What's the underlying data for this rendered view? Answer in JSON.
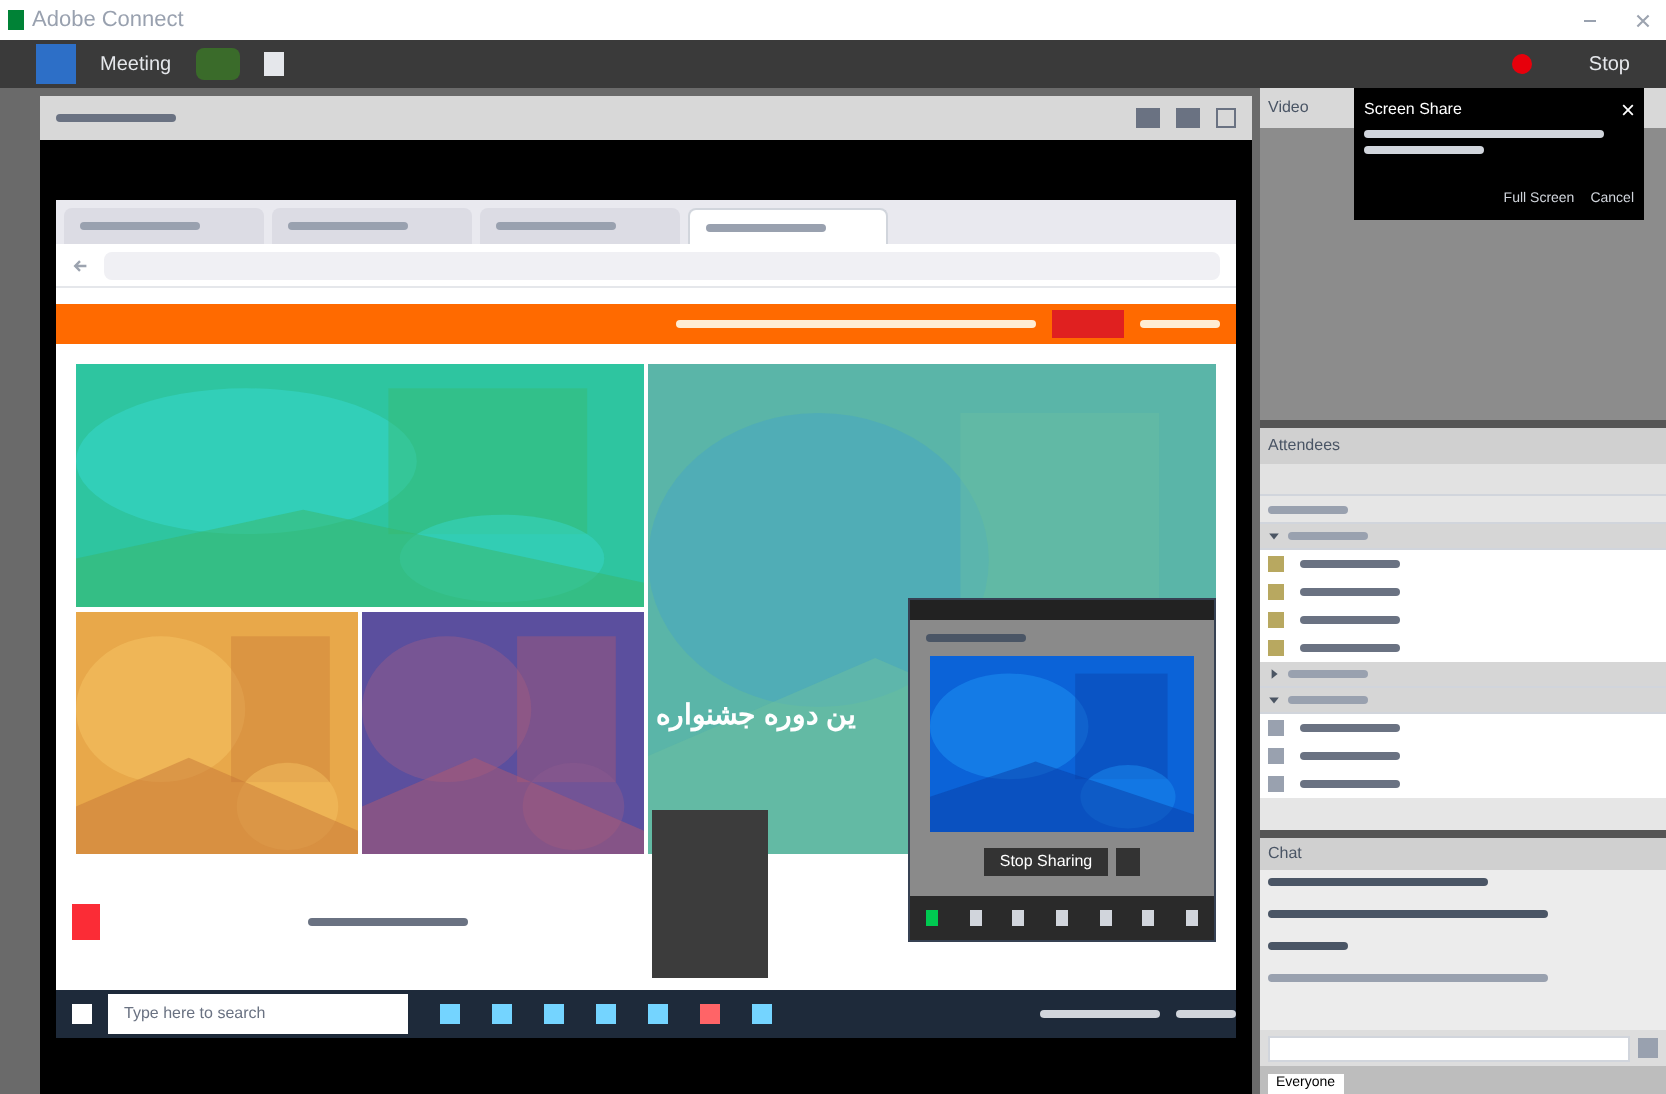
{
  "window": {
    "title": "Adobe Connect"
  },
  "menu_bar": {
    "items": [
      {
        "label": "Meeting"
      }
    ],
    "stop_label": "Stop"
  },
  "browser": {
    "tabs": [
      {
        "selected": false
      },
      {
        "selected": false
      },
      {
        "selected": false
      },
      {
        "selected": true
      }
    ]
  },
  "hero": {
    "heading": "ین دوره جشنواره"
  },
  "taskbar": {
    "search_placeholder": "Type here to search"
  },
  "mini_window": {
    "button": "Stop Sharing"
  },
  "notification": {
    "title": "Screen Share",
    "actions": [
      "Full Screen",
      "Cancel"
    ]
  },
  "video_pod": {
    "title": "Video"
  },
  "attendees": {
    "title": "Attendees",
    "groups": [
      {
        "expanded": true,
        "rows": [
          {
            "kind": "host"
          },
          {
            "kind": "host"
          },
          {
            "kind": "host"
          },
          {
            "kind": "host"
          }
        ]
      },
      {
        "expanded": false
      },
      {
        "expanded": true,
        "rows": [
          {
            "kind": "participant"
          },
          {
            "kind": "participant"
          },
          {
            "kind": "participant"
          }
        ]
      }
    ]
  },
  "chat": {
    "title": "Chat",
    "tab": "Everyone"
  }
}
